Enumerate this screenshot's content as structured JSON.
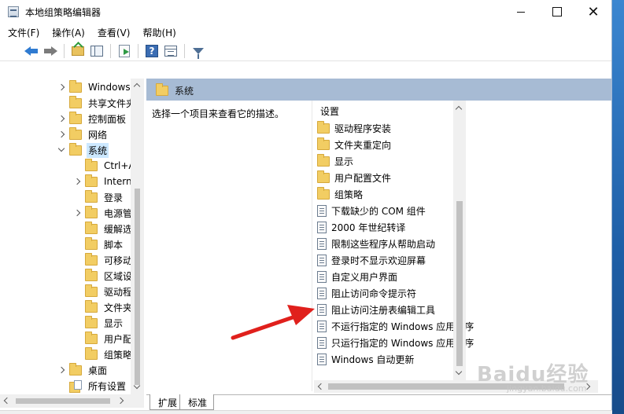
{
  "window": {
    "title": "本地组策略编辑器"
  },
  "menu": [
    "文件(F)",
    "操作(A)",
    "查看(V)",
    "帮助(H)"
  ],
  "toolbar": {
    "help_glyph": "?"
  },
  "tree": {
    "items": [
      {
        "label": "Windows",
        "expander": "collapsed",
        "indent": 0,
        "icon": "folder-icon"
      },
      {
        "label": "共享文件夹",
        "expander": "none",
        "indent": 0,
        "icon": "folder-icon"
      },
      {
        "label": "控制面板",
        "expander": "collapsed",
        "indent": 0,
        "icon": "folder-icon"
      },
      {
        "label": "网络",
        "expander": "collapsed",
        "indent": 0,
        "icon": "folder-icon"
      },
      {
        "label": "系统",
        "expander": "expanded",
        "indent": 0,
        "icon": "folder-icon",
        "selected": true
      },
      {
        "label": "Ctrl+A",
        "expander": "none",
        "indent": 1,
        "icon": "folder-icon"
      },
      {
        "label": "Intern",
        "expander": "collapsed",
        "indent": 1,
        "icon": "folder-icon"
      },
      {
        "label": "登录",
        "expander": "none",
        "indent": 1,
        "icon": "folder-icon"
      },
      {
        "label": "电源管",
        "expander": "collapsed",
        "indent": 1,
        "icon": "folder-icon"
      },
      {
        "label": "缓解选",
        "expander": "none",
        "indent": 1,
        "icon": "folder-icon"
      },
      {
        "label": "脚本",
        "expander": "none",
        "indent": 1,
        "icon": "folder-icon"
      },
      {
        "label": "可移动",
        "expander": "none",
        "indent": 1,
        "icon": "folder-icon"
      },
      {
        "label": "区域设",
        "expander": "none",
        "indent": 1,
        "icon": "folder-icon"
      },
      {
        "label": "驱动程",
        "expander": "none",
        "indent": 1,
        "icon": "folder-icon"
      },
      {
        "label": "文件夹",
        "expander": "none",
        "indent": 1,
        "icon": "folder-icon"
      },
      {
        "label": "显示",
        "expander": "none",
        "indent": 1,
        "icon": "folder-icon"
      },
      {
        "label": "用户配",
        "expander": "none",
        "indent": 1,
        "icon": "folder-icon"
      },
      {
        "label": "组策略",
        "expander": "none",
        "indent": 1,
        "icon": "folder-icon"
      },
      {
        "label": "桌面",
        "expander": "collapsed",
        "indent": 0,
        "icon": "folder-icon"
      },
      {
        "label": "所有设置",
        "expander": "none",
        "indent": 0,
        "icon": "settings-icon"
      }
    ]
  },
  "right": {
    "header_title": "系统",
    "description": "选择一个项目来查看它的描述。",
    "column_header": "设置",
    "items": [
      {
        "label": "驱动程序安装",
        "type": "folder"
      },
      {
        "label": "文件夹重定向",
        "type": "folder"
      },
      {
        "label": "显示",
        "type": "folder"
      },
      {
        "label": "用户配置文件",
        "type": "folder"
      },
      {
        "label": "组策略",
        "type": "folder"
      },
      {
        "label": "下载缺少的 COM 组件",
        "type": "policy"
      },
      {
        "label": "2000 年世纪转译",
        "type": "policy"
      },
      {
        "label": "限制这些程序从帮助启动",
        "type": "policy"
      },
      {
        "label": "登录时不显示欢迎屏幕",
        "type": "policy"
      },
      {
        "label": "自定义用户界面",
        "type": "policy"
      },
      {
        "label": "阻止访问命令提示符",
        "type": "policy"
      },
      {
        "label": "阻止访问注册表编辑工具",
        "type": "policy"
      },
      {
        "label": "不运行指定的 Windows 应用程序",
        "type": "policy"
      },
      {
        "label": "只运行指定的 Windows 应用程序",
        "type": "policy"
      },
      {
        "label": "Windows 自动更新",
        "type": "policy"
      }
    ]
  },
  "tabs": [
    "扩展",
    "标准"
  ],
  "watermark": {
    "main": "Baidu经验",
    "sub": "jingyan.baidu.com"
  },
  "colors": {
    "header_strip": "#a7bbd4",
    "selection": "#cce8ff",
    "arrow": "#e0201c",
    "folder": "#f2cd63"
  }
}
